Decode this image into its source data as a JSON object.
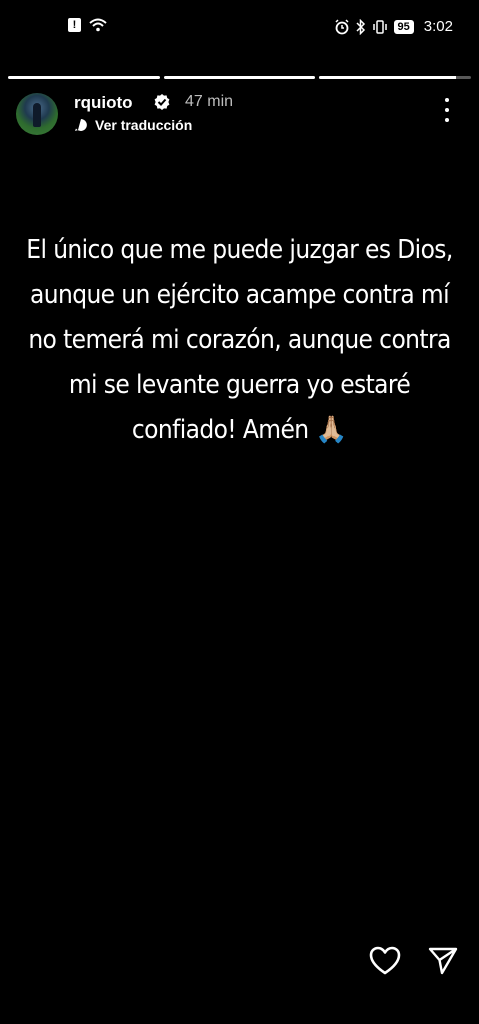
{
  "status_bar": {
    "time": "3:02",
    "battery": "95"
  },
  "story": {
    "segments": [
      1,
      1,
      0.9
    ],
    "username": "rquioto",
    "time_ago": "47 min",
    "translate_label": "Ver traducción",
    "text_lines": [
      "El único que me puede juzgar es Dios,",
      "aunque un ejército acampe contra mí",
      "no temerá mi corazón, aunque contra",
      "mi se levante guerra yo estaré",
      "confiado! Amén 🙏🏼"
    ]
  },
  "icons": {
    "notification": "alert-icon",
    "wifi": "wifi-icon",
    "alarm": "alarm-icon",
    "bluetooth": "bluetooth-icon",
    "vibrate": "vibrate-icon",
    "verified": "verified-badge-icon",
    "translate": "translate-icon",
    "more": "more-options-icon",
    "like": "heart-icon",
    "share": "send-icon"
  }
}
